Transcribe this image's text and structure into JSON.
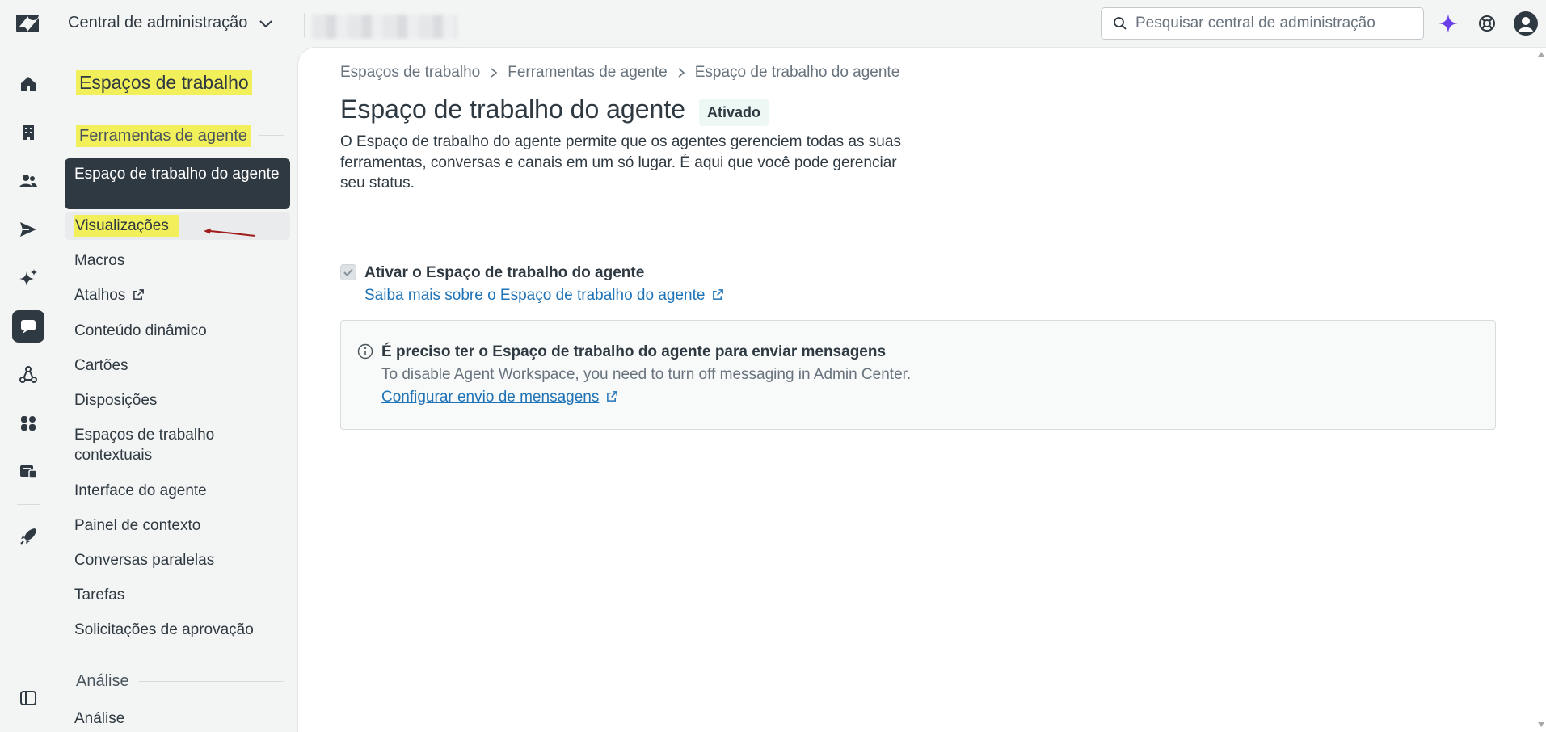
{
  "topbar": {
    "product_name": "Central de administração",
    "search_placeholder": "Pesquisar central de administração"
  },
  "sidebar": {
    "workspace_header": "Espaços de trabalho",
    "section_agent_tools": "Ferramentas de agente",
    "items": [
      {
        "label": "Espaço de trabalho do agente"
      },
      {
        "label": "Visualizações"
      },
      {
        "label": "Macros"
      },
      {
        "label": "Atalhos"
      },
      {
        "label": "Conteúdo dinâmico"
      },
      {
        "label": "Cartões"
      },
      {
        "label": "Disposições"
      },
      {
        "label": "Espaços de trabalho contextuais"
      },
      {
        "label": "Interface do agente"
      },
      {
        "label": "Painel de contexto"
      },
      {
        "label": "Conversas paralelas"
      },
      {
        "label": "Tarefas"
      },
      {
        "label": "Solicitações de aprovação"
      }
    ],
    "section_analysis": "Análise",
    "analysis_items": [
      {
        "label": "Análise"
      }
    ]
  },
  "main": {
    "breadcrumb": [
      "Espaços de trabalho",
      "Ferramentas de agente",
      "Espaço de trabalho do agente"
    ],
    "title": "Espaço de trabalho do agente",
    "status_badge": "Ativado",
    "description": "O Espaço de trabalho do agente permite que os agentes gerenciem todas as suas ferramentas, conversas e canais em um só lugar. É aqui que você pode gerenciar seu status.",
    "checkbox_label": "Ativar o Espaço de trabalho do agente",
    "checkbox_checked": true,
    "learn_more_link": "Saiba mais sobre o Espaço de trabalho do agente",
    "notice": {
      "title": "É preciso ter o Espaço de trabalho do agente para enviar mensagens",
      "body": "To disable Agent Workspace, you need to turn off messaging in Admin Center.",
      "link": "Configurar envio de mensagens"
    }
  },
  "colors": {
    "highlight": "#f2f05a",
    "selected_nav": "#2f3941",
    "link": "#1f73b7",
    "badge_bg": "#edf8f4",
    "ai_icon": "#6a3ee8",
    "annotation_arrow": "#a01c1c"
  },
  "icons": {
    "rail": [
      "home-icon",
      "building-icon",
      "users-icon",
      "send-icon",
      "sparkle-icon",
      "workspaces-icon",
      "objects-icon",
      "apps-icon",
      "account-icon",
      "rocket-icon",
      "sidebar-toggle-icon"
    ],
    "top": [
      "search-icon",
      "ai-sparkle-icon",
      "help-icon",
      "avatar"
    ]
  }
}
